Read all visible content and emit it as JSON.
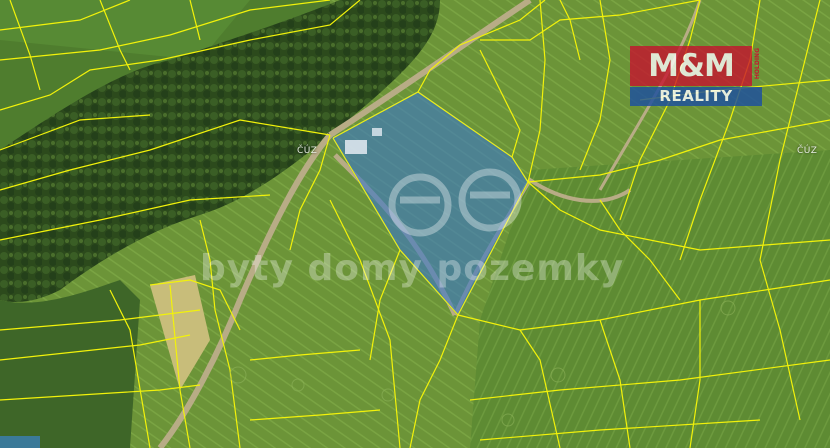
{
  "map": {
    "cadastral_label_left": "ČÚZ",
    "cadastral_label_right": "ČÚZ",
    "watermark_text": "byty domy pozemky",
    "logo": {
      "brand": "M&M",
      "sub": "REALITY",
      "holding": "HOLDING"
    },
    "colors": {
      "parcel_lines": "#f2f20a",
      "highlight_fill": "#3a78c8",
      "highlight_stroke": "#3a78c8",
      "forest": "#2f4f1e",
      "field": "#6f9a3a",
      "logo_red": "#c8102e",
      "logo_blue": "#1c4fa0"
    },
    "icons": [
      "watermark-circles-icon"
    ]
  }
}
